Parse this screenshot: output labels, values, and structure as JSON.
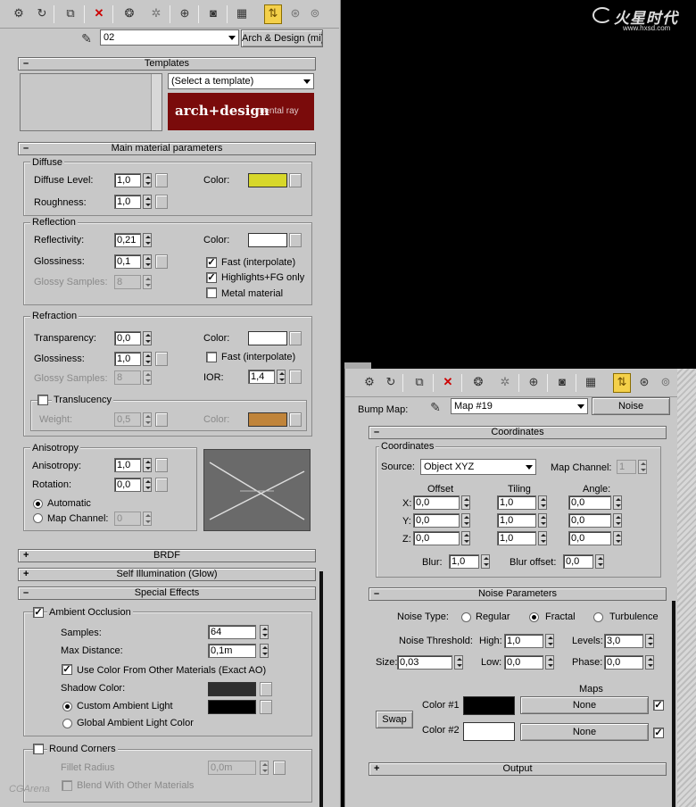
{
  "watermark_top": {
    "brand": "火星时代",
    "url": "www.hxsd.com"
  },
  "watermark_bottom": "CGArena",
  "left": {
    "material_name": "02",
    "material_type": "Arch & Design (mi)",
    "templates": {
      "title": "Templates",
      "select": "(Select a template)",
      "banner_main": "arch+design",
      "banner_sub": "mental ray"
    },
    "main_params": {
      "title": "Main material parameters",
      "diffuse": {
        "group": "Diffuse",
        "level_label": "Diffuse Level:",
        "level": "1,0",
        "roughness_label": "Roughness:",
        "roughness": "1,0",
        "color_label": "Color:",
        "color": "#d7d72a"
      },
      "reflection": {
        "group": "Reflection",
        "reflectivity_label": "Reflectivity:",
        "reflectivity": "0,21",
        "glossiness_label": "Glossiness:",
        "glossiness": "0,1",
        "samples_label": "Glossy Samples:",
        "samples": "8",
        "color_label": "Color:",
        "color": "#ffffff",
        "fast_label": "Fast (interpolate)",
        "highlights_label": "Highlights+FG only",
        "metal_label": "Metal material"
      },
      "refraction": {
        "group": "Refraction",
        "transparency_label": "Transparency:",
        "transparency": "0,0",
        "glossiness_label": "Glossiness:",
        "glossiness": "1,0",
        "samples_label": "Glossy Samples:",
        "samples": "8",
        "color_label": "Color:",
        "color": "#ffffff",
        "fast_label": "Fast (interpolate)",
        "ior_label": "IOR:",
        "ior": "1,4",
        "translucency_label": "Translucency",
        "weight_label": "Weight:",
        "weight": "0,5",
        "trans_color_label": "Color:",
        "trans_color": "#c0843a"
      },
      "anisotropy": {
        "group": "Anisotropy",
        "aniso_label": "Anisotropy:",
        "aniso": "1,0",
        "rotation_label": "Rotation:",
        "rotation": "0,0",
        "automatic_label": "Automatic",
        "channel_label": "Map Channel:",
        "channel": "0"
      }
    },
    "brdf_title": "BRDF",
    "selfillum_title": "Self Illumination (Glow)",
    "special": {
      "title": "Special Effects",
      "ao_label": "Ambient Occlusion",
      "samples_label": "Samples:",
      "samples": "64",
      "maxdist_label": "Max Distance:",
      "maxdist": "0,1m",
      "usecolor_label": "Use Color From Other Materials (Exact AO)",
      "shadow_label": "Shadow Color:",
      "shadow_color": "#2e2e2e",
      "custom_label": "Custom Ambient Light",
      "custom_color": "#000000",
      "global_label": "Global Ambient Light Color",
      "round_label": "Round Corners",
      "fillet_label": "Fillet Radius",
      "fillet": "0,0m",
      "blend_label": "Blend With Other Materials"
    }
  },
  "right": {
    "bump_label": "Bump Map:",
    "map_name": "Map #19",
    "map_type": "Noise",
    "coordinates": {
      "title": "Coordinates",
      "group": "Coordinates",
      "source_label": "Source:",
      "source": "Object XYZ",
      "channel_label": "Map Channel:",
      "channel": "1",
      "offset_h": "Offset",
      "tiling_h": "Tiling",
      "angle_h": "Angle:",
      "rows": [
        {
          "axis": "X:",
          "offset": "0,0",
          "tiling": "1,0",
          "angle": "0,0"
        },
        {
          "axis": "Y:",
          "offset": "0,0",
          "tiling": "1,0",
          "angle": "0,0"
        },
        {
          "axis": "Z:",
          "offset": "0,0",
          "tiling": "1,0",
          "angle": "0,0"
        }
      ],
      "blur_label": "Blur:",
      "blur": "1,0",
      "bluroff_label": "Blur offset:",
      "bluroff": "0,0"
    },
    "noise": {
      "title": "Noise Parameters",
      "type_label": "Noise Type:",
      "regular": "Regular",
      "fractal": "Fractal",
      "turbulence": "Turbulence",
      "threshold_label": "Noise Threshold:",
      "high_label": "High:",
      "high": "1,0",
      "levels_label": "Levels:",
      "levels": "3,0",
      "size_label": "Size:",
      "size": "0,03",
      "low_label": "Low:",
      "low": "0,0",
      "phase_label": "Phase:",
      "phase": "0,0",
      "maps_label": "Maps",
      "swap": "Swap",
      "color1_label": "Color #1",
      "color1": "#000000",
      "map1": "None",
      "color2_label": "Color #2",
      "color2": "#ffffff",
      "map2": "None"
    },
    "output_title": "Output"
  }
}
